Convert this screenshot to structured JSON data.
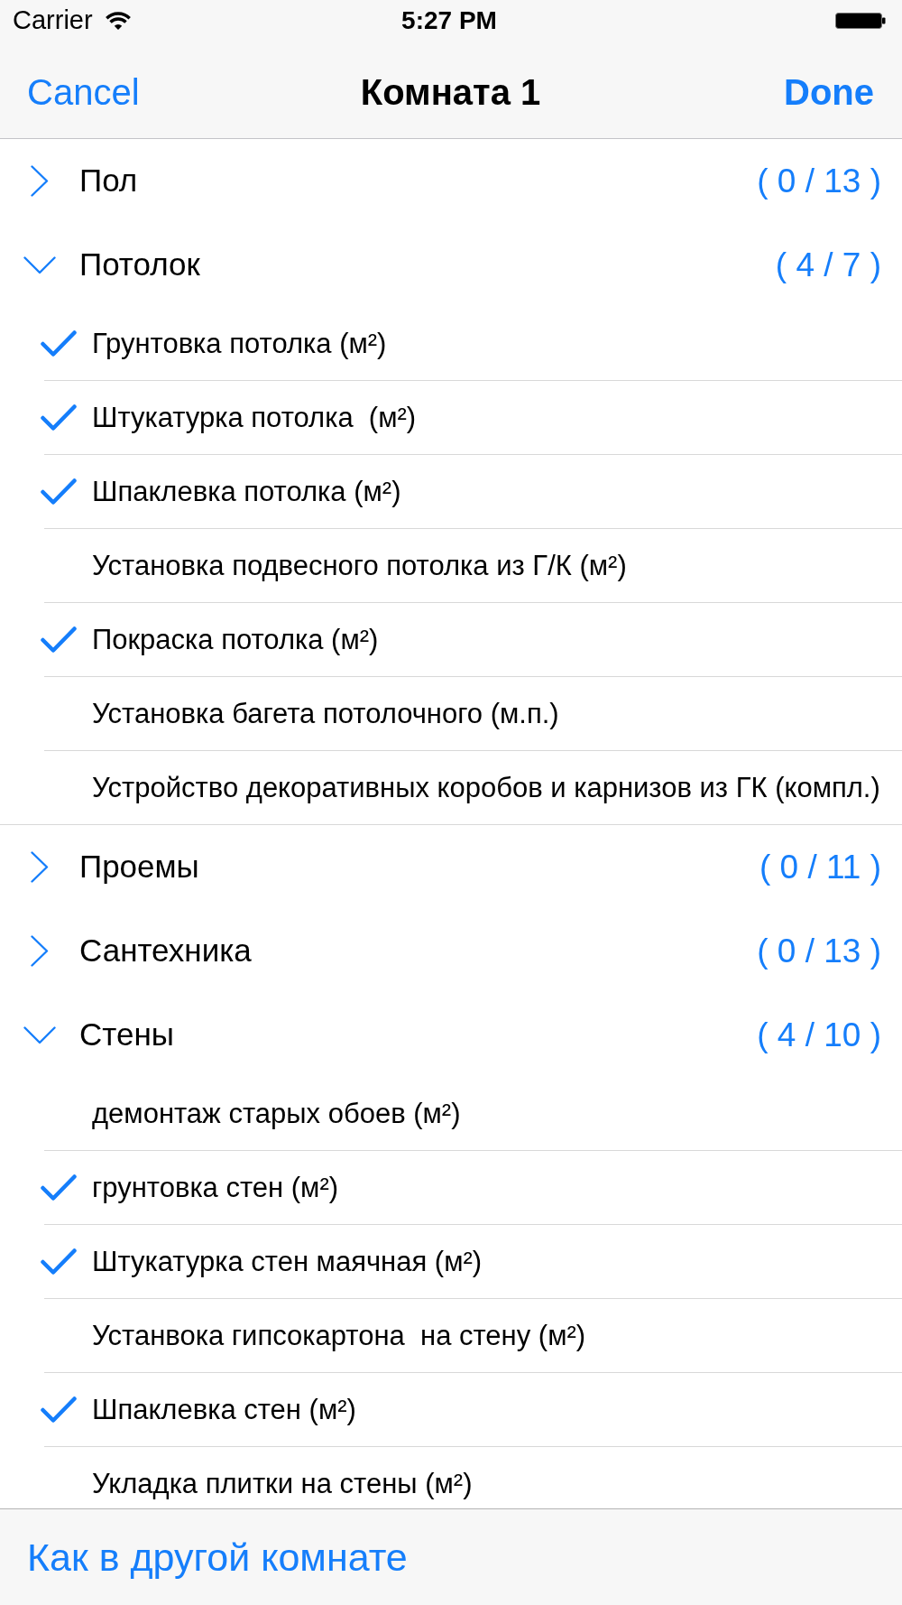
{
  "status_bar": {
    "carrier": "Carrier",
    "time": "5:27 PM"
  },
  "nav_bar": {
    "cancel": "Cancel",
    "title": "Комната 1",
    "done": "Done"
  },
  "sections": [
    {
      "title": "Пол",
      "count": "( 0 / 13 )",
      "expanded": false
    },
    {
      "title": "Потолок",
      "count": "( 4 / 7 )",
      "expanded": true,
      "items": [
        {
          "label": "Грунтовка потолка (м²)",
          "checked": true
        },
        {
          "label": "Штукатурка потолка  (м²)",
          "checked": true
        },
        {
          "label": "Шпаклевка потолка (м²)",
          "checked": true
        },
        {
          "label": "Установка подвесного потолка из Г/К (м²)",
          "checked": false
        },
        {
          "label": "Покраска потолка (м²)",
          "checked": true
        },
        {
          "label": "Установка багета потолочного (м.п.)",
          "checked": false
        },
        {
          "label": "Устройство декоративных коробов и карнизов из ГК (компл.)",
          "checked": false
        }
      ]
    },
    {
      "title": "Проемы",
      "count": "( 0 / 11 )",
      "expanded": false
    },
    {
      "title": "Сантехника",
      "count": "( 0 / 13 )",
      "expanded": false
    },
    {
      "title": "Стены",
      "count": "( 4 / 10 )",
      "expanded": true,
      "items": [
        {
          "label": "демонтаж старых обоев (м²)",
          "checked": false
        },
        {
          "label": "грунтовка стен (м²)",
          "checked": true
        },
        {
          "label": "Штукатурка стен маячная (м²)",
          "checked": true
        },
        {
          "label": "Устанвока гипсокартона  на стену (м²)",
          "checked": false
        },
        {
          "label": "Шпаклевка стен (м²)",
          "checked": true
        },
        {
          "label": "Укладка плитки на стены (м²)",
          "checked": false
        }
      ]
    }
  ],
  "toolbar": {
    "button": "Как в другой комнате"
  }
}
